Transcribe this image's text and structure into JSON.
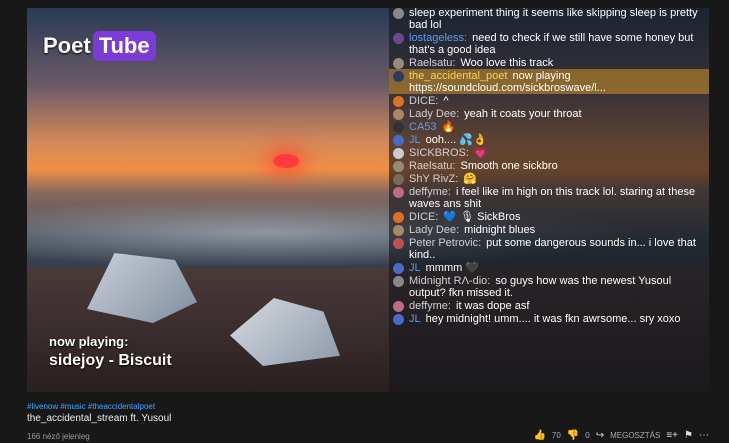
{
  "logo": {
    "part1": "Poet",
    "part2": "Tube"
  },
  "now_playing": {
    "label": "now playing:",
    "track": "sidejoy - Biscuit"
  },
  "chat": [
    {
      "name": "",
      "text": "sleep experiment thing it seems like skipping sleep is pretty bad lol",
      "color": "gray",
      "avatar": "#888888"
    },
    {
      "name": "lostageless:",
      "text": "need to check if we still have some honey but that's a good idea",
      "color": "blue",
      "avatar": "#6a4a8a"
    },
    {
      "name": "Raelsatu:",
      "text": "Woo love this track",
      "color": "gray",
      "avatar": "#9a8a7a"
    },
    {
      "name": "the_accidental_poet",
      "text": "now playing https://soundcloud.com/sickbroswave/l...",
      "color": "gold",
      "avatar": "#2a3a6a",
      "highlight": true
    },
    {
      "name": "DICE:",
      "text": "^",
      "color": "gray",
      "avatar": "#e07020"
    },
    {
      "name": "Lady Dee:",
      "text": "yeah it coats your throat",
      "color": "gray",
      "avatar": "#aa8866"
    },
    {
      "name": "CA53",
      "text": "🔥",
      "color": "blue",
      "avatar": "#333333"
    },
    {
      "name": "JL",
      "text": "ooh.... 💦👌",
      "color": "blue",
      "avatar": "#4a6ac8"
    },
    {
      "name": "SICKBROS:",
      "text": "💗",
      "color": "gray",
      "avatar": "#cccccc"
    },
    {
      "name": "Raelsatu:",
      "text": "Smooth one sickbro",
      "color": "gray",
      "avatar": "#9a8a7a"
    },
    {
      "name": "ShY RivZ:",
      "text": "🤗",
      "color": "gray",
      "avatar": "#7a6a5a"
    },
    {
      "name": "deffyme:",
      "text": "i feel like im high on this track lol. staring at these waves ans shit",
      "color": "gray",
      "avatar": "#c06a8a"
    },
    {
      "name": "DICE:",
      "text": "💙 🎙 SickBros",
      "color": "gray",
      "avatar": "#e07020"
    },
    {
      "name": "Lady Dee:",
      "text": "midnight blues",
      "color": "gray",
      "avatar": "#aa8866"
    },
    {
      "name": "Peter Petrovic:",
      "text": "put some dangerous sounds in... i love that kind..",
      "color": "gray",
      "avatar": "#c05050"
    },
    {
      "name": "JL",
      "text": "mmmm 🖤",
      "color": "blue",
      "avatar": "#4a6ac8"
    },
    {
      "name": "Midnight RΛ-dio:",
      "text": "so guys how was the newest Yusoul output? fkn missed it.",
      "color": "gray",
      "avatar": "#888888"
    },
    {
      "name": "deffyme:",
      "text": "it was dope asf",
      "color": "gray",
      "avatar": "#c06a8a"
    },
    {
      "name": "JL",
      "text": "hey midnight! umm.... it was fkn awrsome... sry xoxo",
      "color": "blue",
      "avatar": "#4a6ac8"
    }
  ],
  "below": {
    "tags": "#livenow #music #theaccidentalpoet",
    "title": "the_accidental_stream ft. Yusoul",
    "views": "166 néző jelenleg"
  },
  "actions": {
    "likes": "70",
    "dislikes": "0",
    "share": "MEGOSZTÁS"
  }
}
